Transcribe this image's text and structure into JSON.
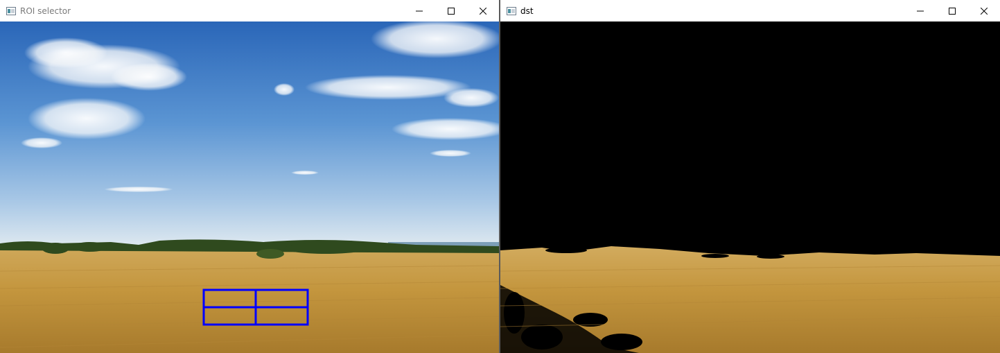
{
  "windows": {
    "roi": {
      "title": "ROI selector",
      "icon": "app-window-icon"
    },
    "dst": {
      "title": "dst",
      "icon": "app-window-icon"
    }
  },
  "controls": {
    "minimize": "minimize-icon",
    "maximize": "maximize-icon",
    "close": "close-icon"
  },
  "roi_grid": {
    "rows": 2,
    "cols": 2,
    "color": "#0000ff"
  },
  "colors": {
    "sky_top": "#2f6fc0",
    "sky_bottom": "#dbe7f1",
    "field": "#c49a45",
    "mask_background": "#000000"
  }
}
